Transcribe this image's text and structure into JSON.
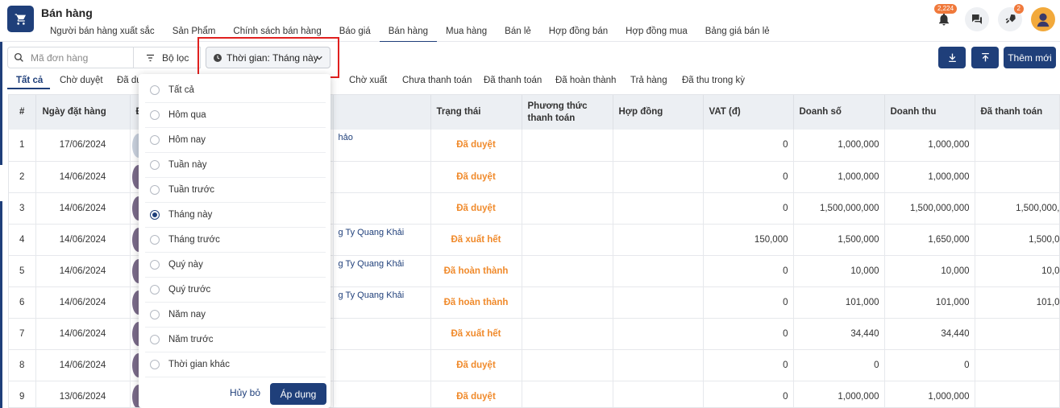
{
  "app": {
    "title": "Bán hàng",
    "icon": "cart-icon"
  },
  "nav": [
    "Người bán hàng xuất sắc",
    "Sản Phẩm",
    "Chính sách bán hàng",
    "Báo giá",
    "Bán hàng",
    "Mua hàng",
    "Bán lẻ",
    "Hợp đồng bán",
    "Hợp đồng mua",
    "Bảng giá bán lẻ"
  ],
  "nav_active": "Bán hàng",
  "top_icons": {
    "notifications_badge": "2,224",
    "rocket_badge": "2"
  },
  "search": {
    "placeholder": "Mã đơn hàng"
  },
  "filter": {
    "label": "Bộ lọc"
  },
  "time_filter": {
    "label": "Thời gian: Tháng này"
  },
  "actions": {
    "download": "download-icon",
    "upload": "upload-icon",
    "add": "Thêm mới"
  },
  "tabs": [
    "Tất cả",
    "Chờ duyệt",
    "Đã du",
    "Chờ xuất",
    "Chưa thanh toán",
    "Đã thanh toán",
    "Đã hoàn thành",
    "Trả hàng",
    "Đã thu trong kỳ"
  ],
  "columns": [
    "#",
    "Ngày đặt hàng",
    "Đ",
    "",
    "Trạng thái",
    "Phương thức thanh toán",
    "Hợp đồng",
    "VAT (đ)",
    "Doanh số",
    "Doanh thu",
    "Đã thanh toán"
  ],
  "rows": [
    {
      "no": "1",
      "date": "17/06/2024",
      "customer": "hảo",
      "status": "Đã duyệt",
      "vat": "0",
      "sales": "1,000,000",
      "revenue": "1,000,000",
      "paid": ""
    },
    {
      "no": "2",
      "date": "14/06/2024",
      "customer": "",
      "status": "Đã duyệt",
      "vat": "0",
      "sales": "1,000,000",
      "revenue": "1,000,000",
      "paid": ""
    },
    {
      "no": "3",
      "date": "14/06/2024",
      "customer": "",
      "status": "Đã duyệt",
      "vat": "0",
      "sales": "1,500,000,000",
      "revenue": "1,500,000,000",
      "paid": "1,500,000,"
    },
    {
      "no": "4",
      "date": "14/06/2024",
      "customer": "g Ty Quang Khải",
      "status": "Đã xuất hết",
      "vat": "150,000",
      "sales": "1,500,000",
      "revenue": "1,650,000",
      "paid": "1,500,0"
    },
    {
      "no": "5",
      "date": "14/06/2024",
      "customer": "g Ty Quang Khải",
      "status": "Đã hoàn thành",
      "vat": "0",
      "sales": "10,000",
      "revenue": "10,000",
      "paid": "10,0"
    },
    {
      "no": "6",
      "date": "14/06/2024",
      "customer": "g Ty Quang Khải",
      "status": "Đã hoàn thành",
      "vat": "0",
      "sales": "101,000",
      "revenue": "101,000",
      "paid": "101,0"
    },
    {
      "no": "7",
      "date": "14/06/2024",
      "customer": "",
      "status": "Đã xuất hết",
      "vat": "0",
      "sales": "34,440",
      "revenue": "34,440",
      "paid": ""
    },
    {
      "no": "8",
      "date": "14/06/2024",
      "customer": "",
      "status": "Đã duyệt",
      "vat": "0",
      "sales": "0",
      "revenue": "0",
      "paid": ""
    },
    {
      "no": "9",
      "date": "13/06/2024",
      "customer": "",
      "status": "Đã duyệt",
      "vat": "0",
      "sales": "1,000,000",
      "revenue": "1,000,000",
      "paid": ""
    }
  ],
  "dropdown": {
    "options": [
      "Tất cả",
      "Hôm qua",
      "Hôm nay",
      "Tuần này",
      "Tuần trước",
      "Tháng này",
      "Tháng trước",
      "Quý này",
      "Quý trước",
      "Năm nay",
      "Năm trước",
      "Thời gian khác"
    ],
    "selected": "Tháng này",
    "cancel": "Hủy bỏ",
    "apply": "Áp dụng"
  },
  "colors": {
    "primary": "#1f3f7a",
    "status": "#f08a2b",
    "highlight": "#e0201f",
    "badge": "#f0793b"
  }
}
